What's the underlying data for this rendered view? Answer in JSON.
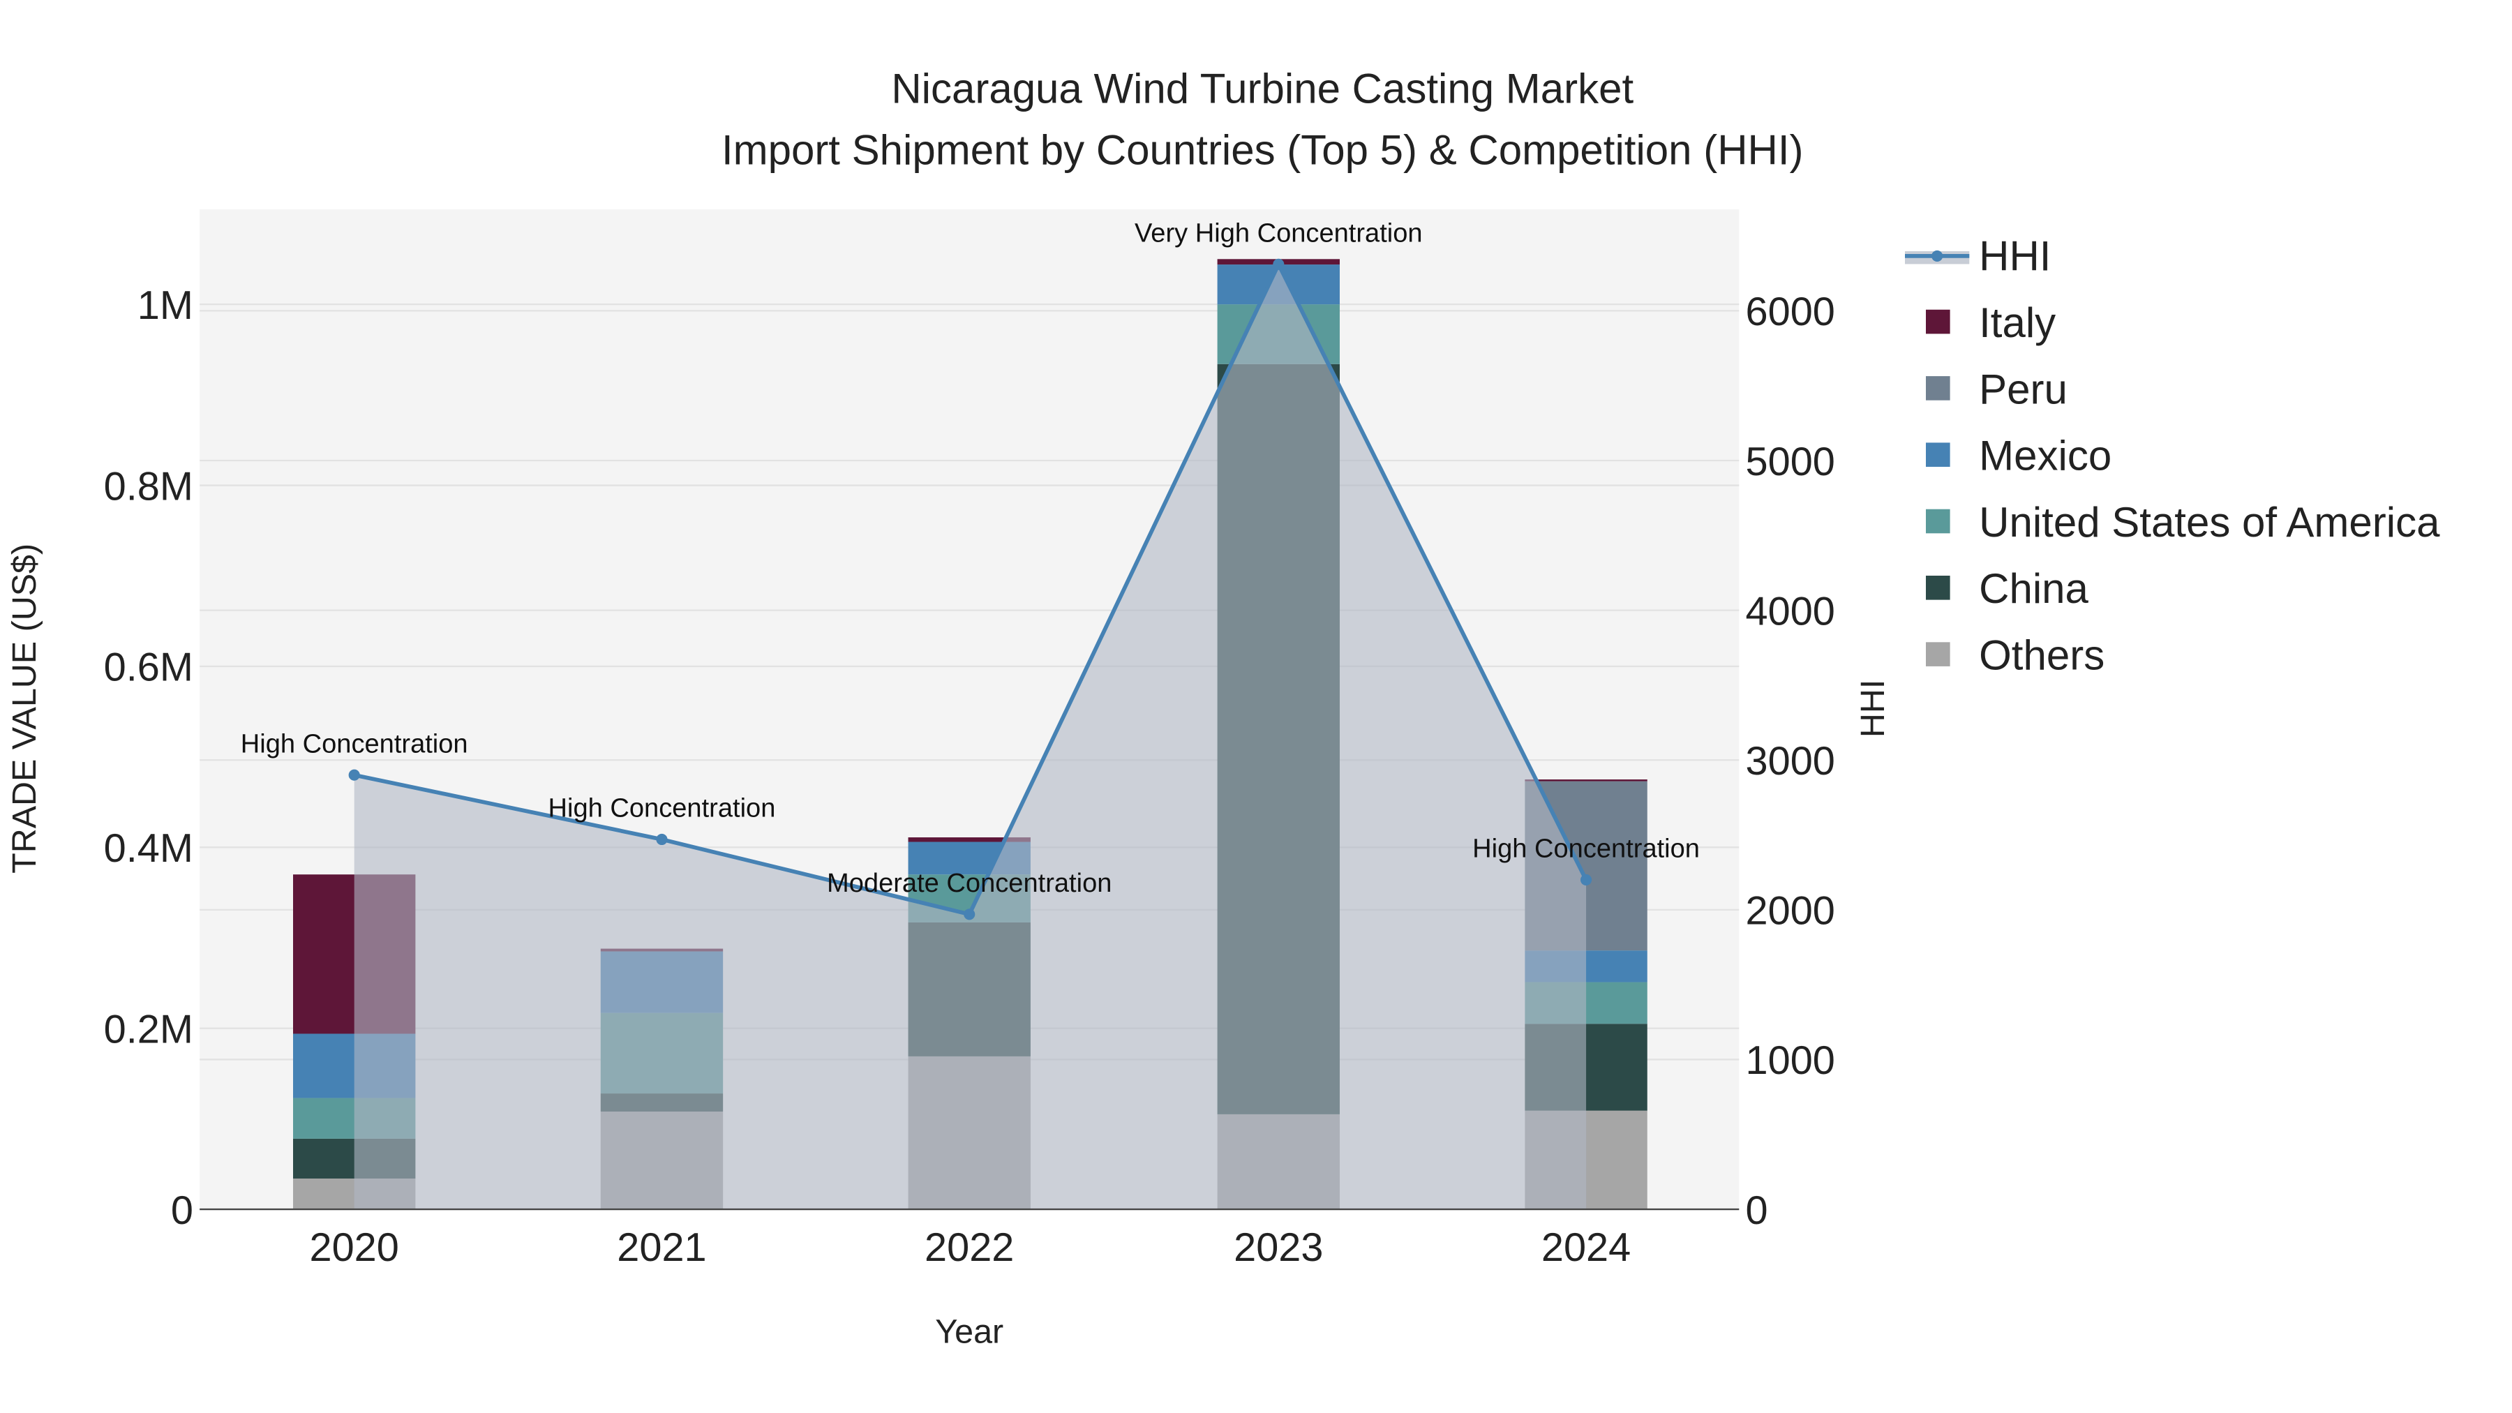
{
  "chart_data": {
    "type": "bar",
    "stacked": true,
    "title": "Nicaragua Wind Turbine Casting Market",
    "subtitle": "Import Shipment by Countries (Top 5) & Competition (HHI)",
    "xlabel": "Year",
    "ylabel": "TRADE VALUE (US$)",
    "y2label": "HHI",
    "categories": [
      "2020",
      "2021",
      "2022",
      "2023",
      "2024"
    ],
    "ylim": [
      0,
      1100000
    ],
    "y2lim": [
      0,
      6650
    ],
    "yticks": [
      {
        "v": 0,
        "label": "0"
      },
      {
        "v": 200000,
        "label": "0.2M"
      },
      {
        "v": 400000,
        "label": "0.4M"
      },
      {
        "v": 600000,
        "label": "0.6M"
      },
      {
        "v": 800000,
        "label": "0.8M"
      },
      {
        "v": 1000000,
        "label": "1M"
      }
    ],
    "y2ticks": [
      {
        "v": 0,
        "label": "0"
      },
      {
        "v": 1000,
        "label": "1000"
      },
      {
        "v": 2000,
        "label": "2000"
      },
      {
        "v": 3000,
        "label": "3000"
      },
      {
        "v": 4000,
        "label": "4000"
      },
      {
        "v": 5000,
        "label": "5000"
      },
      {
        "v": 6000,
        "label": "6000"
      }
    ],
    "series": [
      {
        "name": "Others",
        "color": "#a6a6a6",
        "values": [
          34000,
          108000,
          169000,
          105000,
          109000
        ]
      },
      {
        "name": "China",
        "color": "#2c4a48",
        "values": [
          44000,
          20000,
          148000,
          829000,
          96000
        ]
      },
      {
        "name": "United States of America",
        "color": "#5a9a9a",
        "values": [
          45000,
          89000,
          53000,
          66000,
          46000
        ]
      },
      {
        "name": "Mexico",
        "color": "#4682b4",
        "values": [
          71000,
          68000,
          36000,
          44000,
          35000
        ]
      },
      {
        "name": "Peru",
        "color": "#708090",
        "values": [
          0,
          0,
          0,
          0,
          187000
        ]
      },
      {
        "name": "Italy",
        "color": "#5e1638",
        "values": [
          176000,
          3000,
          5000,
          6000,
          2000
        ]
      }
    ],
    "hhi": {
      "name": "HHI",
      "color": "#4682b4",
      "values": [
        2900,
        2470,
        1970,
        6310,
        2200
      ],
      "annotations": [
        "High Concentration",
        "High Concentration",
        "Moderate Concentration",
        "Very High Concentration",
        "High Concentration"
      ]
    },
    "legend_order": [
      "HHI",
      "Italy",
      "Peru",
      "Mexico",
      "United States of America",
      "China",
      "Others"
    ],
    "legend_placement": "right",
    "grid": true
  }
}
